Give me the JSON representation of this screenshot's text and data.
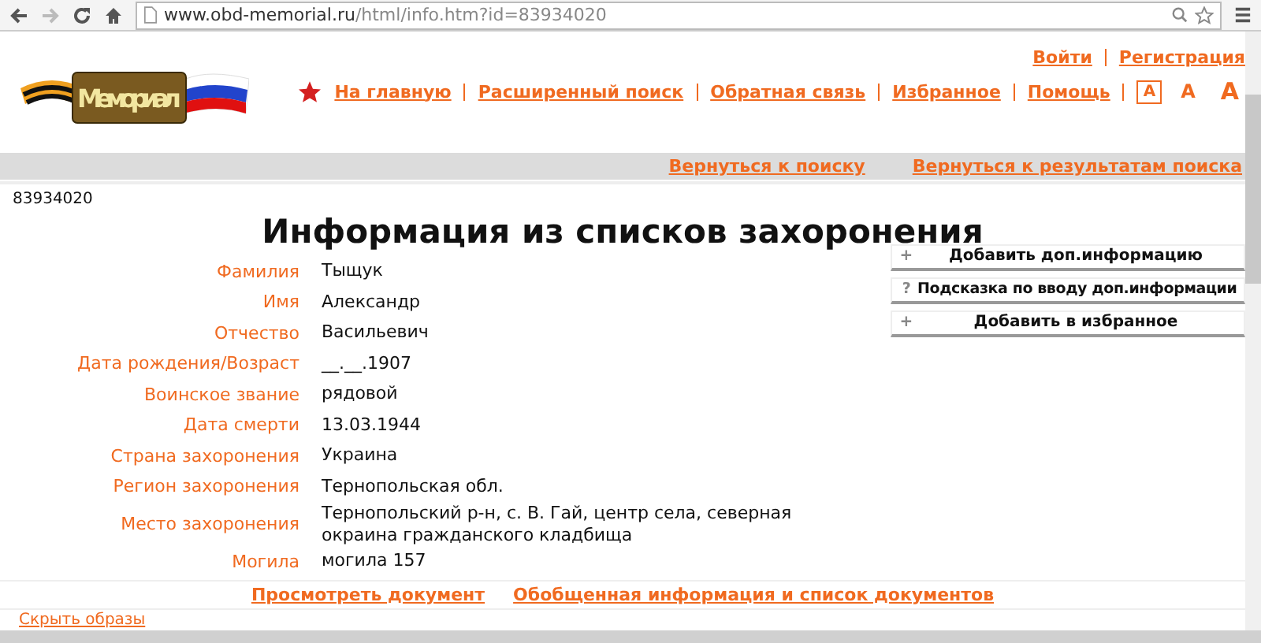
{
  "browser": {
    "url_host": "www.obd-memorial.ru",
    "url_path": "/html/info.htm?id=83934020"
  },
  "header": {
    "logo_text": "Мемориал",
    "account_links": [
      "Войти",
      "Регистрация"
    ],
    "nav_links": [
      "На главную",
      "Расширенный поиск",
      "Обратная связь",
      "Избранное",
      "Помощь"
    ],
    "font_sizes": [
      {
        "label": "А",
        "selected": true
      },
      {
        "label": "А",
        "selected": false
      },
      {
        "label": "А",
        "selected": false
      }
    ]
  },
  "back_links": [
    "Вернуться к поиску",
    "Вернуться к результатам поиска"
  ],
  "record_id": "83934020",
  "title": "Информация из списков захоронения",
  "fields": [
    {
      "label": "Фамилия",
      "value": "Тыщук"
    },
    {
      "label": "Имя",
      "value": "Александр"
    },
    {
      "label": "Отчество",
      "value": "Васильевич"
    },
    {
      "label": "Дата рождения/Возраст",
      "value": "__.__.1907"
    },
    {
      "label": "Воинское звание",
      "value": "рядовой"
    },
    {
      "label": "Дата смерти",
      "value": "13.03.1944"
    },
    {
      "label": "Страна захоронения",
      "value": "Украина"
    },
    {
      "label": "Регион захоронения",
      "value": "Тернопольская обл."
    },
    {
      "label": "Место захоронения",
      "value": "Тернопольский р-н, с. В. Гай, центр села, северная окраина гражданского кладбища"
    },
    {
      "label": "Могила",
      "value": "могила 157"
    }
  ],
  "actions": [
    {
      "kind": "plus",
      "symbol": "+",
      "label": "Добавить доп.информацию"
    },
    {
      "kind": "help",
      "symbol": "?",
      "label": "Подсказка по вводу доп.информации"
    },
    {
      "kind": "plus",
      "symbol": "+",
      "label": "Добавить в избранное"
    }
  ],
  "document_links": [
    "Просмотреть документ",
    "Обобщенная информация и список документов"
  ],
  "hide_images_link": "Скрыть образы"
}
